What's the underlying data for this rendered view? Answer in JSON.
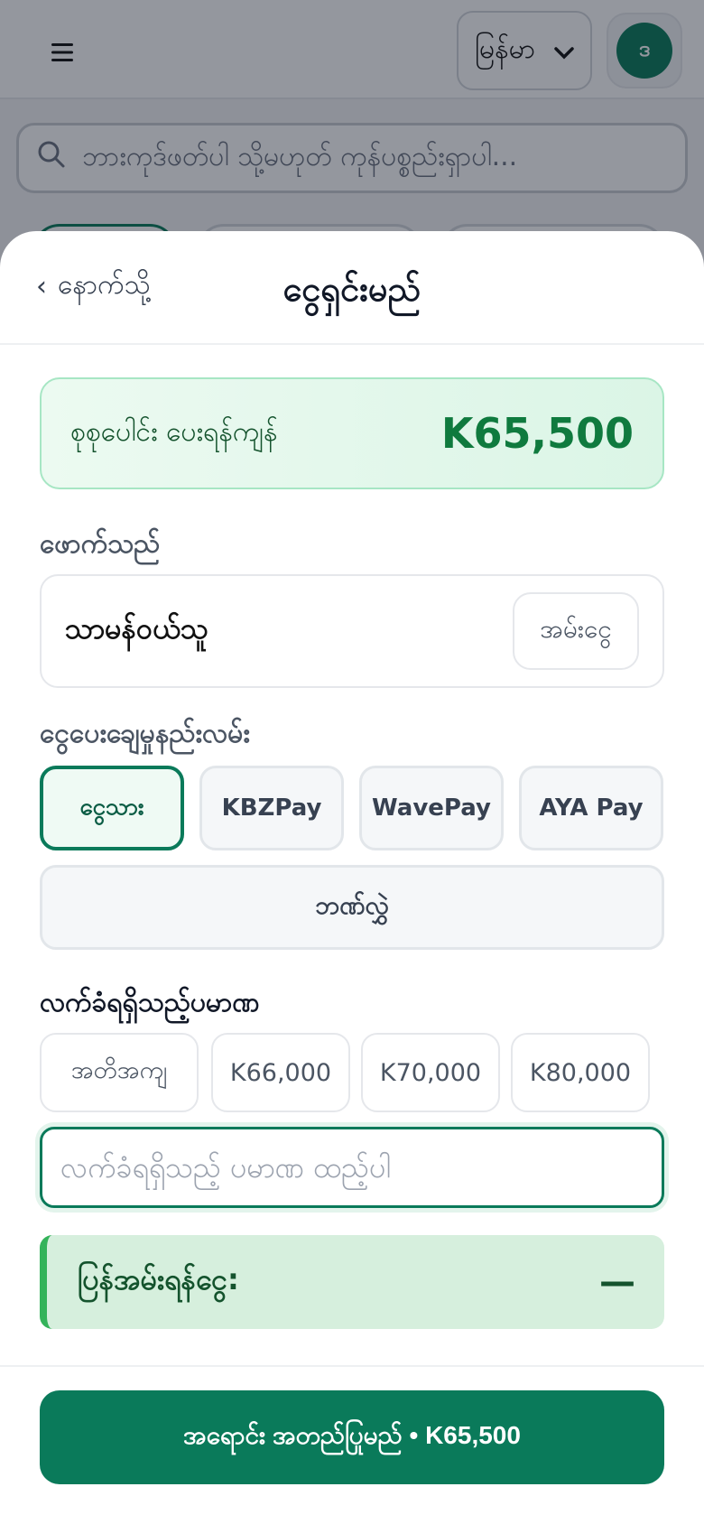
{
  "header": {
    "language_selected": "မြန်မာ",
    "avatar_initial": "ဒ"
  },
  "search": {
    "placeholder": "ဘားကုဒ်ဖတ်ပါ သို့မဟုတ် ကုန်ပစ္စည်းရှာပါ..."
  },
  "sheet": {
    "back_label": "နောက်သို့",
    "title": "ငွေရှင်းမည်",
    "total": {
      "label": "စုစုပေါင်း ပေးရန်ကျန်",
      "value": "K65,500"
    },
    "customer": {
      "section_label": "ဖောက်သည်",
      "name": "သာမန်ဝယ်သူ",
      "button_label": "အမ်းငွေ"
    },
    "payment": {
      "section_label": "ငွေပေးချေမှုနည်းလမ်း",
      "methods": [
        "ငွေသား",
        "KBZPay",
        "WavePay",
        "AYA Pay"
      ],
      "selected_index": 0,
      "wide_method": "ဘဏ်လွှဲ"
    },
    "received": {
      "section_label": "လက်ခံရရှိသည့်ပမာဏ",
      "quick_amounts": [
        "အတိအကျ",
        "K66,000",
        "K70,000",
        "K80,000"
      ],
      "input_value": "",
      "input_placeholder": "လက်ခံရရှိသည့် ပမာဏ ထည့်ပါ"
    },
    "change": {
      "label": "ပြန်အမ်းရန်ငွေ:",
      "value": "—"
    },
    "confirm_label": "အရောင်း အတည်ပြုမည် • K65,500"
  },
  "colors": {
    "primary": "#0a7a5a",
    "total_value": "#0f7a3e",
    "change_accent": "#34b35a"
  },
  "icons": [
    "hamburger-icon",
    "chevron-down-icon",
    "search-icon",
    "chevron-left-icon"
  ]
}
